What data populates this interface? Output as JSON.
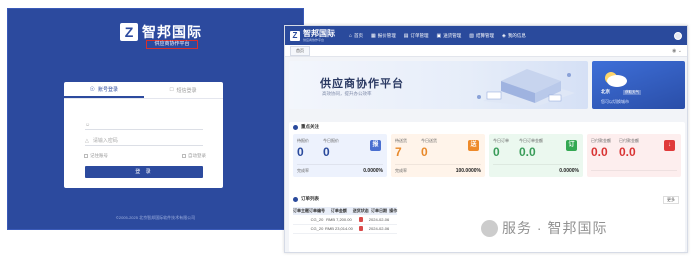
{
  "login": {
    "brand_name": "智邦国际",
    "brand_sub": "供应商协作平台",
    "tabs": [
      {
        "label": "账号登录",
        "icon": "user-icon"
      },
      {
        "label": "短信登录",
        "icon": "phone-icon"
      }
    ],
    "username_placeholder": "",
    "password_placeholder": "请输入密码",
    "remember_label": "记住账号",
    "auto_label": "自动登录",
    "submit_label": "登 录",
    "copyright": "©2005-2025  北京智邦国际软件技术有限公司"
  },
  "dashboard": {
    "logo_name": "智邦国际",
    "logo_sub": "供应商协作平台",
    "nav": [
      {
        "label": "首页",
        "icon": "home-icon"
      },
      {
        "label": "报价管理",
        "icon": "quote-icon"
      },
      {
        "label": "订单管理",
        "icon": "order-icon"
      },
      {
        "label": "送货管理",
        "icon": "truck-icon"
      },
      {
        "label": "结算管理",
        "icon": "settle-icon"
      },
      {
        "label": "我的信息",
        "icon": "info-icon"
      }
    ],
    "tab": "首页",
    "banner_title": "供应商协作平台",
    "banner_sub": "高效协同，提升办公效率",
    "weather": {
      "place": "北京",
      "btn": "获取天气",
      "hint": "您可以切换城市"
    },
    "focus_title": "重点关注",
    "cards": [
      {
        "color": "blue",
        "labels": [
          "待报价",
          "今日报价"
        ],
        "values": [
          "0",
          "0"
        ],
        "units": [
          "",
          ""
        ],
        "badge": "报",
        "foot_label": "完成率",
        "foot_value": "0.0000%"
      },
      {
        "color": "orange",
        "labels": [
          "待送货",
          "今日送货"
        ],
        "values": [
          "7",
          "0"
        ],
        "units": [
          "",
          ""
        ],
        "badge": "送",
        "foot_label": "完成率",
        "foot_value": "100.0000%"
      },
      {
        "color": "green",
        "labels": [
          "今日订单",
          "今日订单金额"
        ],
        "values": [
          "0",
          "0.0"
        ],
        "units": [
          "",
          ""
        ],
        "badge": "订",
        "foot_label": "",
        "foot_value": "0.0000%"
      },
      {
        "color": "red",
        "labels": [
          "已付款金额",
          "已付款金额"
        ],
        "values": [
          "0.0",
          "0.0"
        ],
        "units": [
          "",
          ""
        ],
        "badge": "↓",
        "foot_label": "",
        "foot_value": ""
      }
    ],
    "orders_title": "订单列表",
    "orders_more": "更多",
    "order_columns": [
      "订单主题",
      "订单编号",
      "订单金额",
      "送货状态",
      "订单日期",
      "操作"
    ],
    "orders": [
      {
        "subject": "",
        "no": "CG_20",
        "amount": "RMB 7,200.00",
        "status": "",
        "date": "2024-02-06"
      },
      {
        "subject": "",
        "no": "CG_20",
        "amount": "RMB 23,014.00",
        "status": "",
        "date": "2024-02-06"
      }
    ]
  },
  "watermark": "服务 · 智邦国际"
}
